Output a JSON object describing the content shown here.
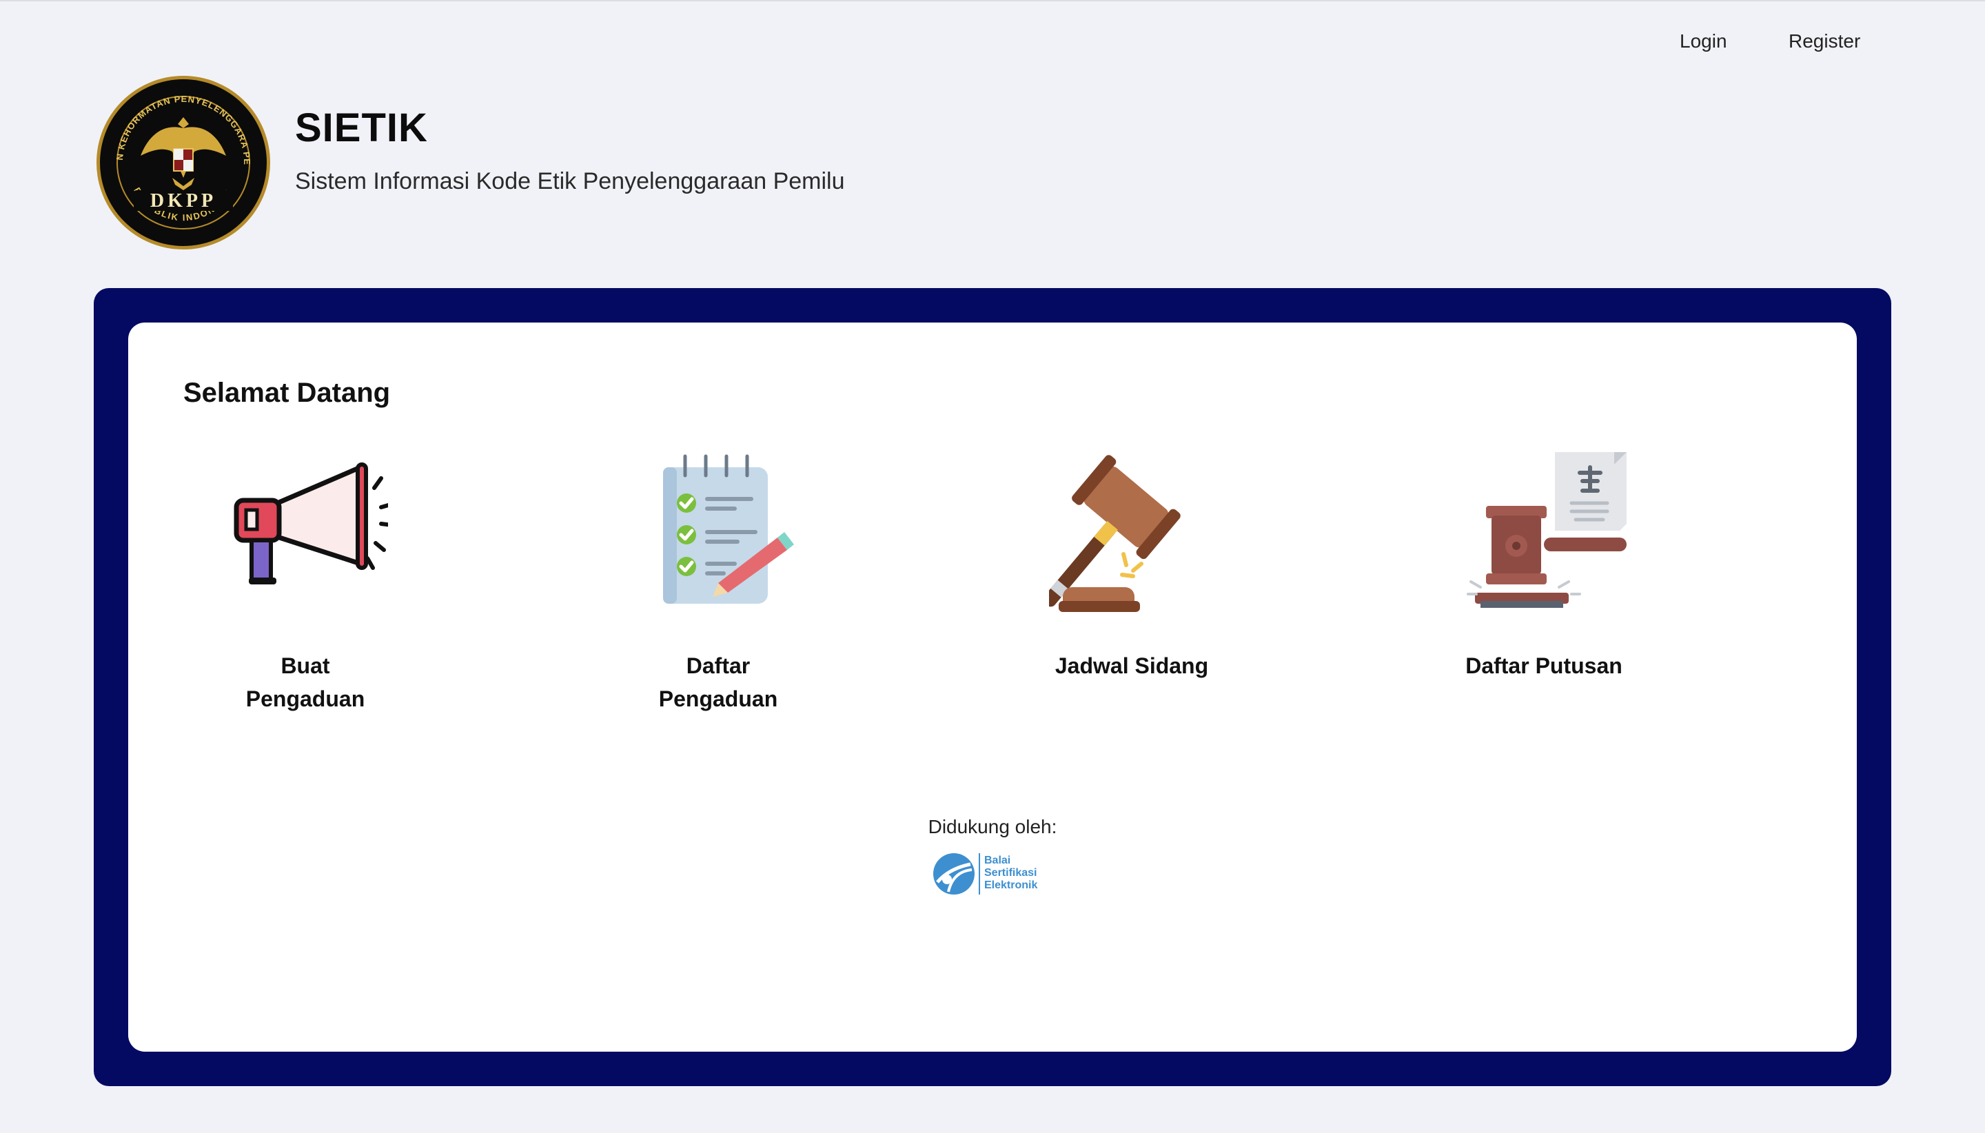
{
  "nav": {
    "login": "Login",
    "register": "Register"
  },
  "brand": {
    "title": "SIETIK",
    "subtitle": "Sistem Informasi Kode Etik Penyelenggaraan Pemilu",
    "logo_top_text": "DEWAN KEHORMATAN PENYELENGGARA PEMILU",
    "logo_center_text": "DKPP",
    "logo_bottom_text": "REPUBLIK INDONESIA"
  },
  "main": {
    "welcome": "Selamat Datang",
    "tiles": [
      {
        "line1": "Buat",
        "line2": "Pengaduan",
        "icon": "megaphone-icon"
      },
      {
        "line1": "Daftar",
        "line2": "Pengaduan",
        "icon": "checklist-icon"
      },
      {
        "line1": "Jadwal Sidang",
        "icon": "gavel-icon"
      },
      {
        "line1": "Daftar Putusan",
        "icon": "verdict-icon"
      }
    ],
    "support_label": "Didukung oleh:",
    "support_logo": {
      "line1": "Balai",
      "line2": "Sertifikasi",
      "line3": "Elektronik"
    }
  },
  "colors": {
    "frame": "#040a62",
    "background": "#f1f2f7",
    "card": "#ffffff",
    "accent_blue": "#3d8fd0"
  }
}
